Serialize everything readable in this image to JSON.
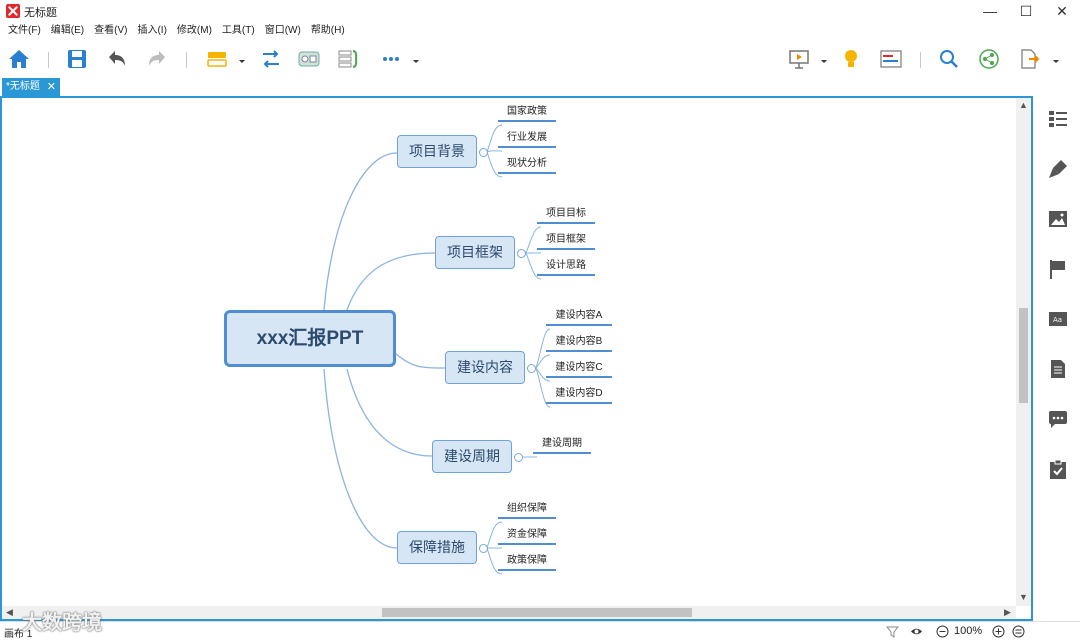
{
  "window": {
    "title": "无标题",
    "minimize": "—",
    "maximize": "☐",
    "close": "✕"
  },
  "menu": [
    "文件(F)",
    "编辑(E)",
    "查看(V)",
    "插入(I)",
    "修改(M)",
    "工具(T)",
    "窗口(W)",
    "帮助(H)"
  ],
  "tab": {
    "label": "*无标题",
    "close": "✕"
  },
  "mindmap": {
    "root": "xxx汇报PPT",
    "branches": [
      {
        "label": "项目背景",
        "leaves": [
          "国家政策",
          "行业发展",
          "现状分析"
        ]
      },
      {
        "label": "项目框架",
        "leaves": [
          "项目目标",
          "项目框架",
          "设计思路"
        ]
      },
      {
        "label": "建设内容",
        "leaves": [
          "建设内容A",
          "建设内容B",
          "建设内容C",
          "建设内容D"
        ]
      },
      {
        "label": "建设周期",
        "leaves": [
          "建设周期"
        ]
      },
      {
        "label": "保障措施",
        "leaves": [
          "组织保障",
          "资金保障",
          "政策保障"
        ]
      }
    ]
  },
  "status": {
    "sheet": "画布 1",
    "zoom": "100%",
    "watermark": "大数跨境"
  },
  "colors": {
    "accent": "#2b97d5",
    "node_fill": "#d6e6f4",
    "node_border": "#4f8ed3",
    "node_text": "#2c4a6e"
  }
}
